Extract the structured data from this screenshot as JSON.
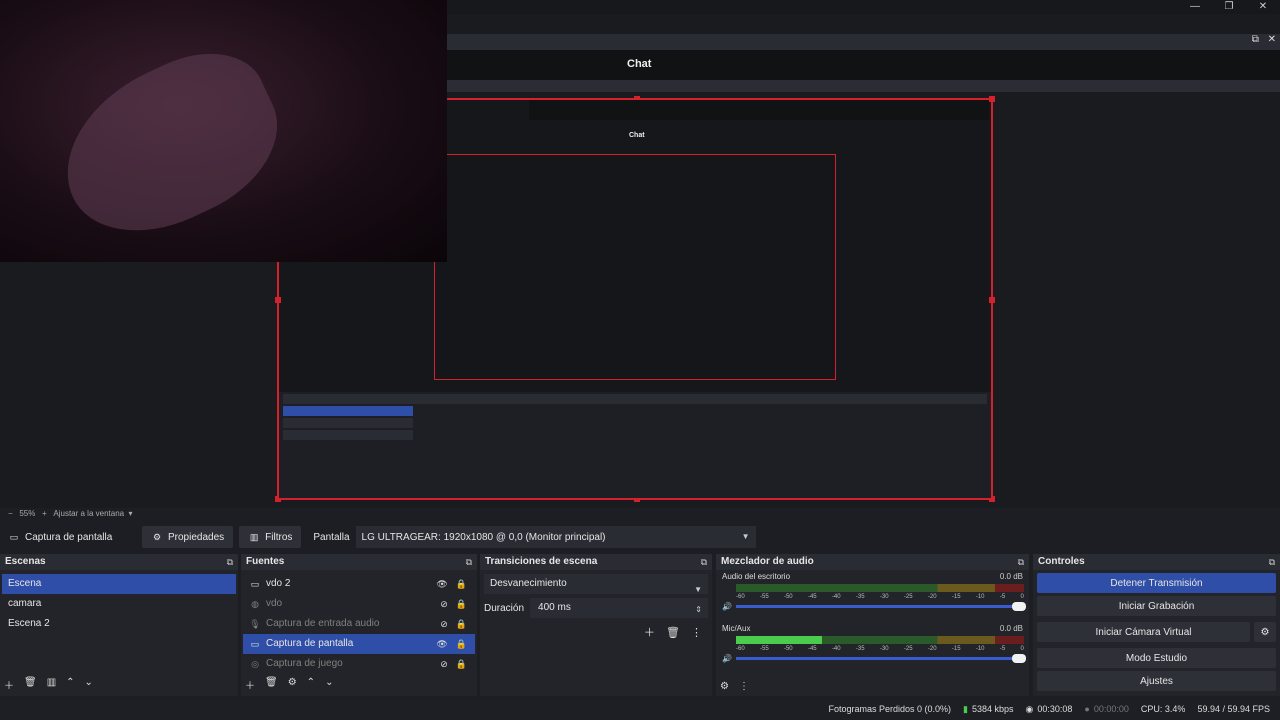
{
  "window_controls": [
    "—",
    "❐",
    "✕"
  ],
  "dock_controls": [
    "⧉",
    "✕"
  ],
  "chat": {
    "title": "Chat"
  },
  "zoom": {
    "minus": "−",
    "level": "55%",
    "plus": "+",
    "fit": "Ajustar a la ventana"
  },
  "toolbar": {
    "source_name": "Captura de pantalla",
    "properties_label": "Propiedades",
    "filters_label": "Filtros",
    "screen_label": "Pantalla",
    "screen_value": "LG ULTRAGEAR: 1920x1080 @ 0,0 (Monitor principal)"
  },
  "scenes": {
    "title": "Escenas",
    "items": [
      "Escena",
      "camara",
      "Escena 2"
    ],
    "selected": 0
  },
  "sources": {
    "title": "Fuentes",
    "items": [
      {
        "label": "vdo 2",
        "icon": "monitor-icon",
        "visible": true,
        "active": true
      },
      {
        "label": "vdo",
        "icon": "globe-icon",
        "visible": false,
        "active": false
      },
      {
        "label": "Captura de entrada audio",
        "icon": "mic-icon",
        "visible": false,
        "active": false
      },
      {
        "label": "Captura de pantalla",
        "icon": "monitor-icon",
        "visible": true,
        "active": true
      },
      {
        "label": "Captura de juego",
        "icon": "gamepad-icon",
        "visible": false,
        "active": false
      }
    ],
    "selected": 3
  },
  "transitions": {
    "title": "Transiciones de escena",
    "type": "Desvanecimiento",
    "duration_label": "Duración",
    "duration_value": "400 ms"
  },
  "mixer": {
    "title": "Mezclador de audio",
    "channels": [
      {
        "name": "Audio del escritorio",
        "db": "0.0 dB",
        "level": 0
      },
      {
        "name": "Mic/Aux",
        "db": "0.0 dB",
        "level": 0.3
      }
    ],
    "scale": [
      "-60",
      "-55",
      "-50",
      "-45",
      "-40",
      "-35",
      "-30",
      "-25",
      "-20",
      "-15",
      "-10",
      "-5",
      "0"
    ]
  },
  "controls": {
    "title": "Controles",
    "stop_stream": "Detener Transmisión",
    "start_record": "Iniciar Grabación",
    "virtual_cam": "Iniciar Cámara Virtual",
    "studio_mode": "Modo Estudio",
    "settings": "Ajustes"
  },
  "status": {
    "dropped": "Fotogramas Perdidos 0 (0.0%)",
    "bitrate": "5384 kbps",
    "stream_time": "00:30:08",
    "record_time": "00:00:00",
    "cpu": "CPU: 3.4%",
    "fps": "59.94 / 59.94 FPS"
  },
  "colors": {
    "accent": "#2f4ea8",
    "selection_border": "#d4212b"
  }
}
